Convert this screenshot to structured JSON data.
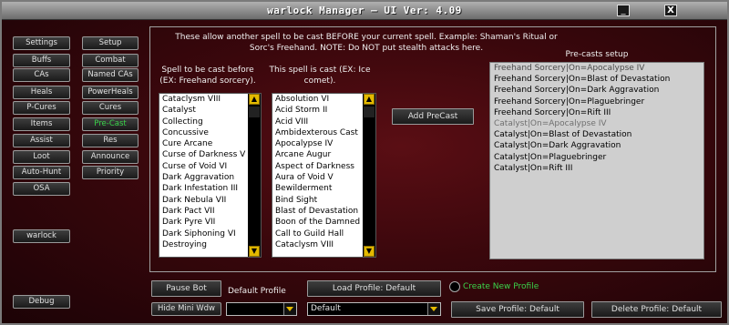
{
  "window": {
    "title": "warlock Manager  — UI Ver: 4.09",
    "minimize_glyph": "_",
    "close_glyph": "X"
  },
  "nav": {
    "left": [
      {
        "label": "Settings"
      },
      {
        "label": "Buffs"
      },
      {
        "label": "CAs"
      },
      {
        "label": "Heals"
      },
      {
        "label": "P-Cures"
      },
      {
        "label": "Items"
      },
      {
        "label": "Assist"
      },
      {
        "label": "Loot"
      },
      {
        "label": "Auto-Hunt"
      },
      {
        "label": "OSA"
      }
    ],
    "right": [
      {
        "label": "Setup"
      },
      {
        "label": "Combat"
      },
      {
        "label": "Named CAs"
      },
      {
        "label": "PowerHeals"
      },
      {
        "label": "Cures"
      },
      {
        "label": "Pre-Cast"
      },
      {
        "label": "Res"
      },
      {
        "label": "Announce"
      },
      {
        "label": "Priority"
      }
    ],
    "active": "Pre-Cast",
    "character": "warlock",
    "debug": "Debug"
  },
  "precast": {
    "description": "These allow another spell to be cast BEFORE your current spell. Example: Shaman's Ritual or Sorc's Freehand. NOTE: Do NOT put stealth attacks here.",
    "before_label": "Spell to be cast before (EX: Freehand sorcery).",
    "cast_label": "This spell is cast (EX: Ice comet).",
    "setup_label": "Pre-casts setup",
    "add_button": "Add PreCast",
    "before_list": [
      "Cataclysm VIII",
      "Catalyst",
      "Collecting",
      "Concussive",
      "Cure Arcane",
      "Curse of Darkness V",
      "Curse of Void VI",
      "Dark Aggravation",
      "Dark Infestation III",
      "Dark Nebula VII",
      "Dark Pact VII",
      "Dark Pyre VII",
      "Dark Siphoning VI",
      "Destroying"
    ],
    "cast_list": [
      "Absolution VI",
      "Acid Storm II",
      "Acid VIII",
      "Ambidexterous Cast",
      "Apocalypse IV",
      "Arcane Augur",
      "Aspect of Darkness",
      "Aura of Void V",
      "Bewilderment",
      "Bind Sight",
      "Blast of Devastation",
      "Boon of the Damned",
      "Call to Guild Hall",
      "Cataclysm VIII"
    ],
    "setup_list": [
      {
        "text": "Freehand Sorcery|On=Apocalypse IV",
        "tone": "dim-dark"
      },
      {
        "text": "Freehand Sorcery|On=Blast of Devastation",
        "tone": "normal"
      },
      {
        "text": "Freehand Sorcery|On=Dark Aggravation",
        "tone": "normal"
      },
      {
        "text": "Freehand Sorcery|On=Plaguebringer",
        "tone": "normal"
      },
      {
        "text": "Freehand Sorcery|On=Rift III",
        "tone": "normal"
      },
      {
        "text": "Catalyst|On=Apocalypse IV",
        "tone": "dim"
      },
      {
        "text": "Catalyst|On=Blast of Devastation",
        "tone": "normal"
      },
      {
        "text": "Catalyst|On=Dark Aggravation",
        "tone": "normal"
      },
      {
        "text": "Catalyst|On=Plaguebringer",
        "tone": "normal"
      },
      {
        "text": "Catalyst|On=Rift III",
        "tone": "normal"
      }
    ]
  },
  "bottom": {
    "pause_bot": "Pause Bot",
    "hide_mini": "Hide Mini Wdw",
    "default_profile_label": "Default Profile",
    "load_profile": "Load Profile: Default",
    "create_new_profile": "Create New Profile",
    "profile_value": "Default",
    "small_combo_value": "",
    "save_profile": "Save Profile: Default",
    "delete_profile": "Delete Profile: Default"
  },
  "colors": {
    "accent_active": "#3ad34a",
    "scroll_arrow": "#e3b900",
    "background": "#3a070c"
  }
}
